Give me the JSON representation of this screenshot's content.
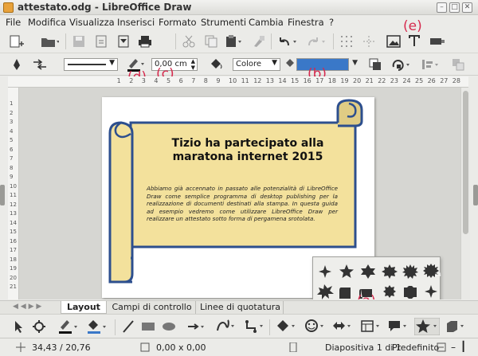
{
  "window": {
    "title": "attestato.odg - LibreOffice Draw"
  },
  "menu": [
    "File",
    "Modifica",
    "Visualizza",
    "Inserisci",
    "Formato",
    "Strumenti",
    "Cambia",
    "Finestra",
    "?"
  ],
  "line_panel": {
    "width_value": "0,00 cm",
    "area_style": "Colore"
  },
  "annotations": {
    "a": "(a)",
    "b": "(b)",
    "c": "(c)",
    "d": "(d)",
    "e": "(e)"
  },
  "ruler_numbers": [
    "1",
    "2",
    "3",
    "4",
    "5",
    "6",
    "7",
    "8",
    "9",
    "10",
    "11",
    "12",
    "13",
    "14",
    "15",
    "16",
    "17",
    "18",
    "19",
    "20",
    "21",
    "22",
    "23",
    "24",
    "25",
    "26",
    "27",
    "28"
  ],
  "vruler_numbers": [
    "1",
    "2",
    "3",
    "4",
    "5",
    "6",
    "7",
    "8",
    "9",
    "10",
    "11",
    "12",
    "13",
    "14",
    "15",
    "16",
    "17",
    "18",
    "19",
    "20",
    "21"
  ],
  "document": {
    "heading": "Tizio ha partecipato alla maratona internet 2015",
    "body": "Abbiamo già accennato in passato alle potenzialità di LibreOffice Draw come semplice programma di desktop publishing per la realizzazione di documenti destinati alla stampa. In questa guida ad esempio vedremo come utilizzare LibreOffice Draw per realizzare un attestato sotto forma di pergamena srotolata."
  },
  "tabs": [
    "Layout",
    "Campi di controllo",
    "Linee di quotatura"
  ],
  "status": {
    "position": "34,43 / 20,76",
    "size": "0,00 x 0,00",
    "slide": "Diapositiva 1 di 1",
    "layout": "Predefinito"
  },
  "colors": {
    "annotation": "#d62a4e",
    "scroll_fill": "#f3e19c",
    "scroll_stroke": "#2d4f8e",
    "area_fill": "#3a78c8"
  }
}
